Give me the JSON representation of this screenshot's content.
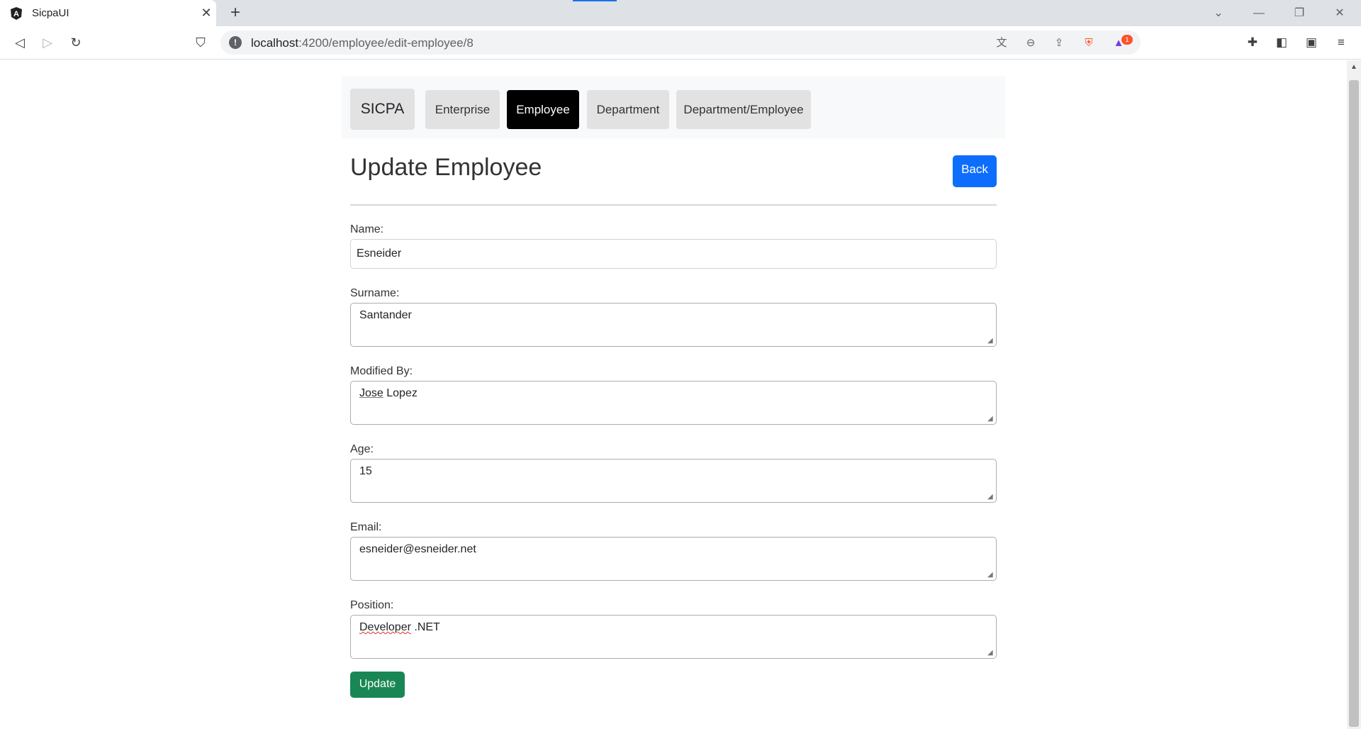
{
  "browser": {
    "tab_title": "SicpaUI",
    "url_host": "localhost",
    "url_path": ":4200/employee/edit-employee/8",
    "badge_count": "1"
  },
  "nav": {
    "brand": "SICPA",
    "items": [
      {
        "label": "Enterprise",
        "active": false
      },
      {
        "label": "Employee",
        "active": true
      },
      {
        "label": "Department",
        "active": false
      },
      {
        "label": "Department/Employee",
        "active": false
      }
    ]
  },
  "page": {
    "title": "Update Employee",
    "back_label": "Back",
    "update_label": "Update"
  },
  "form": {
    "name": {
      "label": "Name:",
      "value": "Esneider"
    },
    "surname": {
      "label": "Surname:",
      "value": "Santander"
    },
    "modified_by": {
      "label": "Modified By:",
      "value_first": "Jose",
      "value_rest": " Lopez"
    },
    "age": {
      "label": "Age:",
      "value": "15"
    },
    "email": {
      "label": "Email:",
      "value": "esneider@esneider.net"
    },
    "position": {
      "label": "Position:",
      "value_first": "Developer",
      "value_rest": " .NET"
    }
  },
  "colors": {
    "primary": "#0d6efd",
    "success": "#198754",
    "nav_active": "#000000",
    "nav_bg": "#f8f9fa"
  }
}
